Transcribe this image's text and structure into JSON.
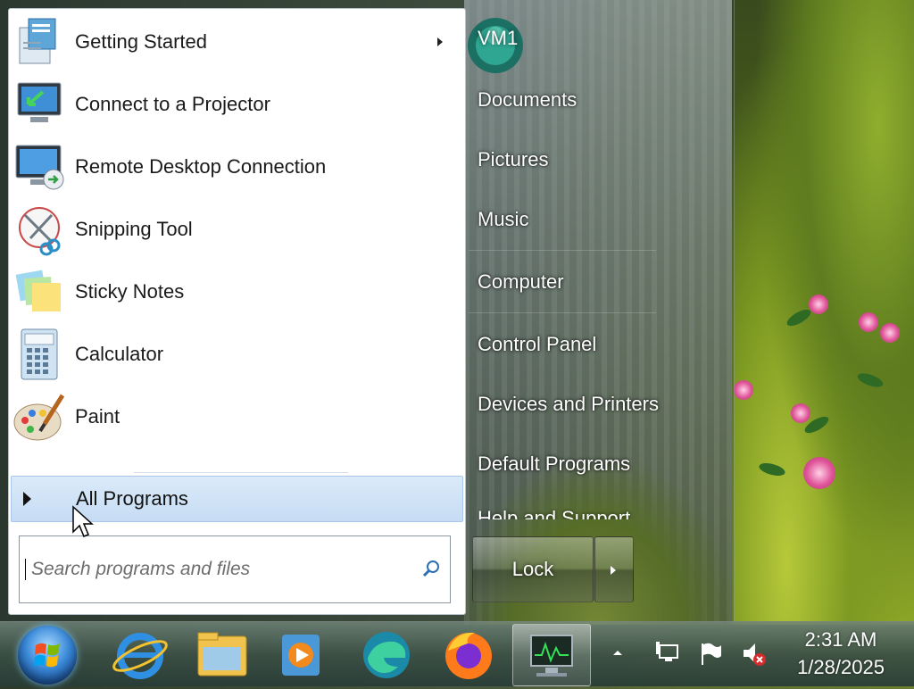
{
  "start_menu": {
    "programs": [
      {
        "label": "Getting Started",
        "icon": "getting-started-icon",
        "has_submenu": true
      },
      {
        "label": "Connect to a Projector",
        "icon": "projector-icon",
        "has_submenu": false
      },
      {
        "label": "Remote Desktop Connection",
        "icon": "remote-desktop-icon",
        "has_submenu": false
      },
      {
        "label": "Snipping Tool",
        "icon": "scissors-icon",
        "has_submenu": false
      },
      {
        "label": "Sticky Notes",
        "icon": "sticky-notes-icon",
        "has_submenu": false
      },
      {
        "label": "Calculator",
        "icon": "calculator-icon",
        "has_submenu": false
      },
      {
        "label": "Paint",
        "icon": "paint-palette-icon",
        "has_submenu": false
      }
    ],
    "all_programs_label": "All Programs",
    "search_placeholder": "Search programs and files",
    "user_name": "VM1",
    "right_items": [
      {
        "label": "Documents"
      },
      {
        "label": "Pictures"
      },
      {
        "label": "Music"
      },
      {
        "label": "Computer"
      },
      {
        "label": "Control Panel"
      },
      {
        "label": "Devices and Printers"
      },
      {
        "label": "Default Programs"
      }
    ],
    "clipped_item_label": "Help and Support",
    "lock_label": "Lock"
  },
  "taskbar": {
    "pinned": [
      {
        "name": "internet-explorer-icon"
      },
      {
        "name": "file-explorer-icon"
      },
      {
        "name": "media-player-icon"
      },
      {
        "name": "edge-icon"
      },
      {
        "name": "firefox-icon"
      },
      {
        "name": "task-manager-icon",
        "active": true
      }
    ],
    "time": "2:31 AM",
    "date": "1/28/2025"
  },
  "colors": {
    "menu_bg": "#ffffff",
    "all_programs_highlight": "#c6dcf4",
    "right_text": "#ffffff"
  }
}
